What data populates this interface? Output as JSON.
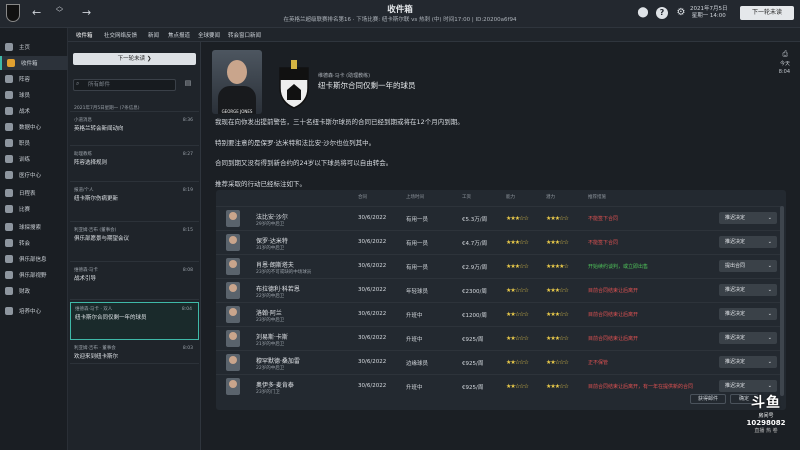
{
  "topbar": {
    "title": "收件箱",
    "subtitle": "在英格兰超级联赛排名第16 · 下场比赛: 纽卡斯尔联 vs 热刺 (中) 时间17:00 | ID:20200a6f94",
    "date_line1": "2021年7月5日",
    "date_line2": "星期一 14:00",
    "continue_label": "下一轮未读"
  },
  "sidebar": {
    "items": [
      {
        "label": "主页"
      },
      {
        "label": "收件箱"
      },
      {
        "label": "阵容"
      },
      {
        "label": "球员"
      },
      {
        "label": "战术"
      },
      {
        "label": "数据中心"
      },
      {
        "label": "职员"
      },
      {
        "label": "训练"
      },
      {
        "label": "医疗中心"
      },
      {
        "label": "日程表"
      },
      {
        "label": "比赛"
      },
      {
        "label": "球探搜索"
      },
      {
        "label": "转会"
      },
      {
        "label": "俱乐部信息"
      },
      {
        "label": "俱乐部视野"
      },
      {
        "label": "财政"
      },
      {
        "label": "培养中心"
      }
    ]
  },
  "tabs": [
    {
      "label": "收件箱"
    },
    {
      "label": "社交网络反馈"
    },
    {
      "label": "新闻"
    },
    {
      "label": "焦点报道"
    },
    {
      "label": "全球要闻"
    },
    {
      "label": "转会窗口新闻"
    }
  ],
  "inbox": {
    "continue_label": "下一轮未读",
    "search_placeholder": "所有邮件",
    "messages": [
      {
        "from": "2021年7月5日星期一 (7条信息)",
        "subject": "",
        "time": ""
      },
      {
        "from": "小道消息",
        "subject": "英格兰转会新闻动向",
        "time": "8:36"
      },
      {
        "from": "助理教练",
        "subject": "阵容选择规则",
        "time": "8:27"
      },
      {
        "from": "报道/个人",
        "subject": "纽卡斯尔伤病更新",
        "time": "8:19"
      },
      {
        "from": "利亚姆·吉布 (董事会)",
        "subject": "俱乐部愿景与期望会议",
        "time": "8:15"
      },
      {
        "from": "维德森·马卡",
        "subject": "战术引导",
        "time": "8:08"
      },
      {
        "from": "维德森·马卡 · 双人",
        "subject": "纽卡斯尔合同仅剩一年的球员",
        "time": "8:04"
      },
      {
        "from": "利亚姆·吉布 · 董事会",
        "subject": "欢迎来到纽卡斯尔",
        "time": "8:03"
      }
    ]
  },
  "main": {
    "photo_caption": "GEORGE JONES",
    "from": "维德森·马卡 (助理教练)",
    "title": "纽卡斯尔合同仅剩一年的球员",
    "time_line1": "今天",
    "time_line2": "8:04",
    "paragraphs": [
      "我现在向你发出提前警告，三十名纽卡斯尔球员的合同已经到期或将在12个月内到期。",
      "特别要注意的是保罗·达米特和法比安·沙尔也位列其中。",
      "合同到期又没有得到新合约的24岁以下球员将可以自由转会。",
      "推荐采取的行动已经标注如下。"
    ],
    "table": {
      "headers": [
        "合同",
        "上场时间",
        "工资",
        "能力",
        "潜力",
        "推荐措施"
      ],
      "rows": [
        {
          "name": "法比安·沙尔",
          "age": "29岁的中后卫",
          "contract": "30/6/2022",
          "role": "有用一员",
          "wage": "€5.3万/周",
          "ca": "★★★☆☆",
          "pa": "★★★☆☆",
          "advice": "不能签下合同",
          "advice_color": "#e05252",
          "decision": "推迟决定"
        },
        {
          "name": "保罗·达米特",
          "age": "31岁的中后卫",
          "contract": "30/6/2022",
          "role": "有用一员",
          "wage": "€4.7万/周",
          "ca": "★★★☆☆",
          "pa": "★★★☆☆",
          "advice": "不能签下合同",
          "advice_color": "#e05252",
          "decision": "推迟决定"
        },
        {
          "name": "肖恩·朗斯塔夫",
          "age": "23岁的不可或缺的中场球员",
          "contract": "30/6/2022",
          "role": "有用一员",
          "wage": "€2.9万/周",
          "ca": "★★★☆☆",
          "pa": "★★★★☆",
          "advice": "开始续约谈判，或立即出售",
          "advice_color": "#4fc35a",
          "decision": "提出合同"
        },
        {
          "name": "布拉德利·科若恩",
          "age": "22岁的中后卫",
          "contract": "30/6/2022",
          "role": "年轻球员",
          "wage": "€2300/周",
          "ca": "★★☆☆☆",
          "pa": "★★★☆☆",
          "advice": "目前合同结束让后离开",
          "advice_color": "#e05252",
          "decision": "推迟决定"
        },
        {
          "name": "洛翰·阿兰",
          "age": "23岁的中后卫",
          "contract": "30/6/2022",
          "role": "升班中",
          "wage": "€1200/周",
          "ca": "★★☆☆☆",
          "pa": "★★★☆☆",
          "advice": "目前合同结束让后离开",
          "advice_color": "#e05252",
          "decision": "推迟决定"
        },
        {
          "name": "刘易斯·卡斯",
          "age": "21岁的中后卫",
          "contract": "30/6/2022",
          "role": "升班中",
          "wage": "€925/周",
          "ca": "★★☆☆☆",
          "pa": "★★★☆☆",
          "advice": "目前合同结束让后离开",
          "advice_color": "#e05252",
          "decision": "推迟决定"
        },
        {
          "name": "穆罕默德·桑加雷",
          "age": "22岁的中后卫",
          "contract": "30/6/2022",
          "role": "边缘球员",
          "wage": "€925/周",
          "ca": "★★☆☆☆",
          "pa": "★★☆☆☆",
          "advice": "正不保管",
          "advice_color": "#e05252",
          "decision": "推迟决定"
        },
        {
          "name": "奥伊多·麦肯泰",
          "age": "23岁的门卫",
          "contract": "30/6/2022",
          "role": "升班中",
          "wage": "€925/周",
          "ca": "★★☆☆☆",
          "pa": "★★★☆☆",
          "advice": "目前合同结束让后离开，有一年在提供新的合同",
          "advice_color": "#e05252",
          "decision": "推迟决定"
        }
      ]
    },
    "btn_more": "获得邮件",
    "btn_ok": "确定"
  },
  "watermark": {
    "brand": "斗鱼",
    "sub": "房间号",
    "room": "10298082",
    "tag": "直播 热 卷"
  },
  "colors": {
    "accent": "#3fb9a8",
    "red": "#e05252",
    "green": "#4fc35a",
    "star": "#e8c94a"
  }
}
